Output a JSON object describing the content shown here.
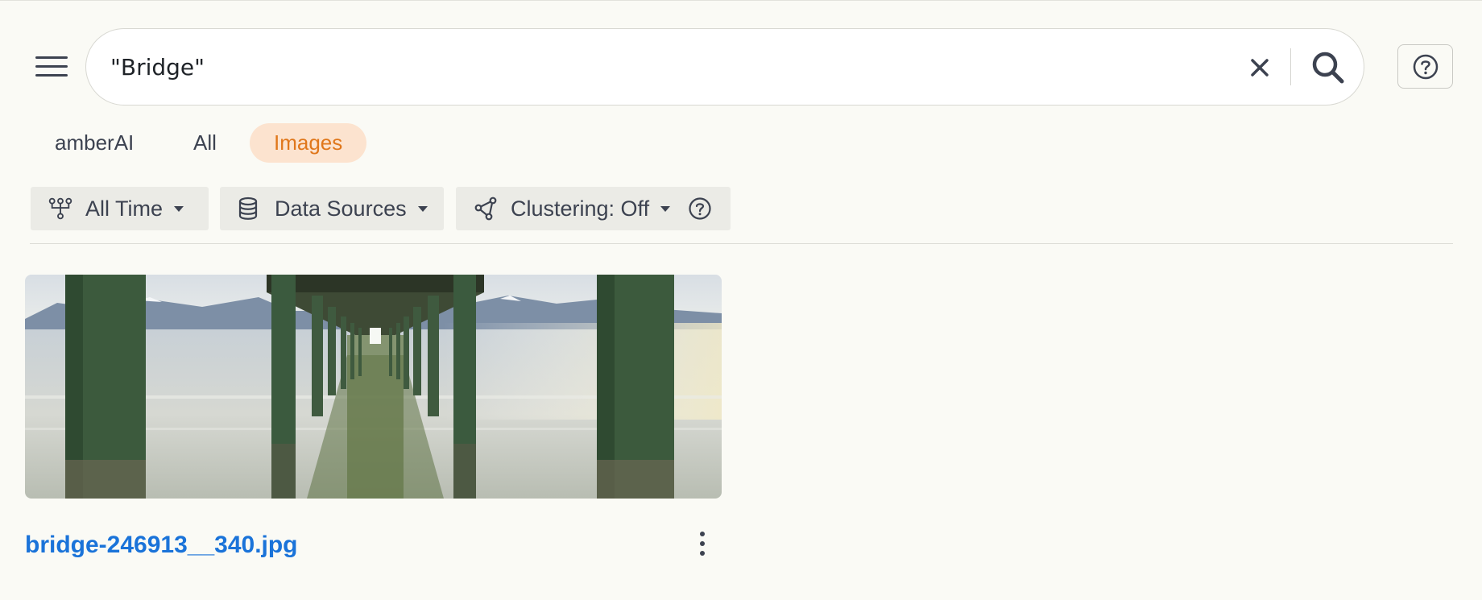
{
  "search": {
    "query": "\"Bridge\"",
    "placeholder": ""
  },
  "tabs": [
    {
      "label": "amberAI",
      "active": false
    },
    {
      "label": "All",
      "active": false
    },
    {
      "label": "Images",
      "active": true
    }
  ],
  "filters": {
    "time": {
      "label": "All Time"
    },
    "sources": {
      "label": "Data Sources"
    },
    "clustering": {
      "label": "Clustering: Off"
    }
  },
  "results": [
    {
      "filename": "bridge-246913__340.jpg",
      "thumbnail": "pier-under-bridge-photo"
    }
  ],
  "colors": {
    "accent": "#e0771b",
    "accent_bg": "#fce3cf",
    "link": "#1a73d9",
    "background": "#fafaf5"
  },
  "icons": {
    "menu": "menu-icon",
    "clear": "close-icon",
    "search": "search-icon",
    "help": "help-icon",
    "time": "timeline-icon",
    "sources": "database-icon",
    "clustering": "cluster-icon",
    "more": "more-vertical-icon"
  }
}
